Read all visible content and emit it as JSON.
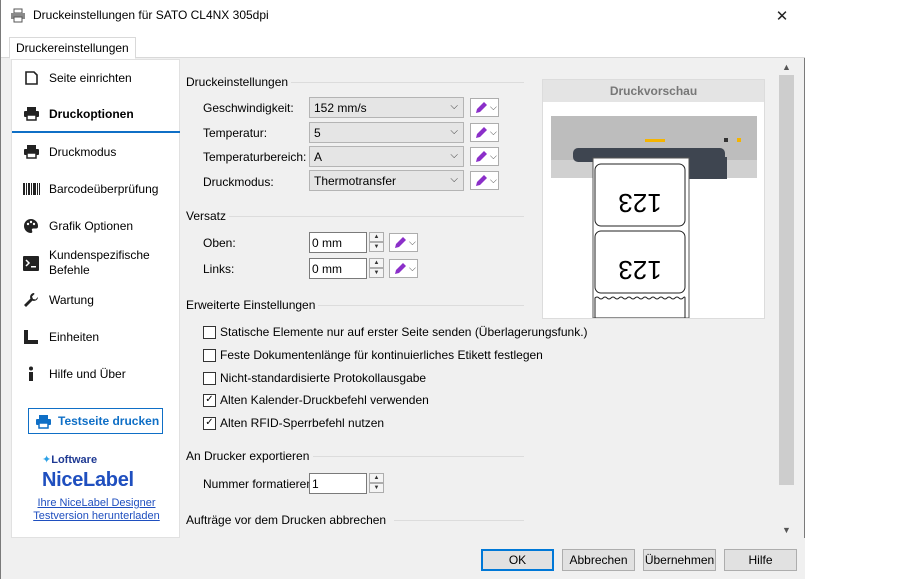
{
  "window": {
    "title": "Druckeinstellungen für SATO CL4NX 305dpi",
    "close": "✕"
  },
  "tabs": [
    {
      "label": "Druckereinstellungen"
    }
  ],
  "sidebar": {
    "items": [
      {
        "label": "Seite einrichten",
        "icon": "page-icon"
      },
      {
        "label": "Druckoptionen",
        "icon": "printer-icon"
      },
      {
        "label": "Druckmodus",
        "icon": "printer-mode-icon"
      },
      {
        "label": "Barcodeüberprüfung",
        "icon": "barcode-icon"
      },
      {
        "label": "Grafik Optionen",
        "icon": "palette-icon"
      },
      {
        "label": "Kundenspezifische Befehle",
        "icon": "terminal-icon"
      },
      {
        "label": "Wartung",
        "icon": "wrench-icon"
      },
      {
        "label": "Einheiten",
        "icon": "ruler-icon"
      },
      {
        "label": "Hilfe und Über",
        "icon": "info-icon"
      }
    ],
    "active_index": 1,
    "test_page_button": "Testseite drucken",
    "brand": {
      "vendor": "Loftware",
      "product": "NiceLabel",
      "link1": "Ihre NiceLabel Designer",
      "link2": "Testversion herunterladen"
    }
  },
  "print_settings": {
    "heading": "Druckeinstellungen",
    "fields": [
      {
        "label": "Geschwindigkeit:",
        "value": "152 mm/s"
      },
      {
        "label": "Temperatur:",
        "value": "5"
      },
      {
        "label": "Temperaturbereich:",
        "value": "A"
      },
      {
        "label": "Druckmodus:",
        "value": "Thermotransfer"
      }
    ]
  },
  "offset": {
    "heading": "Versatz",
    "fields": [
      {
        "label": "Oben:",
        "value": "0 mm"
      },
      {
        "label": "Links:",
        "value": "0 mm"
      }
    ]
  },
  "advanced": {
    "heading": "Erweiterte Einstellungen",
    "checkboxes": [
      {
        "label": "Statische Elemente nur auf erster Seite senden (Überlagerungsfunk.)",
        "checked": false
      },
      {
        "label": "Feste Dokumentenlänge für kontinuierliches Etikett festlegen",
        "checked": false
      },
      {
        "label": "Nicht-standardisierte Protokollausgabe",
        "checked": false
      },
      {
        "label": "Alten Kalender-Druckbefehl verwenden",
        "checked": true
      },
      {
        "label": "Alten RFID-Sperrbefehl nutzen",
        "checked": true
      }
    ]
  },
  "export": {
    "heading": "An Drucker exportieren",
    "field_label": "Nummer formatieren:",
    "field_value": "1"
  },
  "abort": {
    "heading": "Aufträge vor dem Drucken abbrechen"
  },
  "preview": {
    "heading": "Druckvorschau",
    "label_text": "123"
  },
  "footer": {
    "ok": "OK",
    "cancel": "Abbrechen",
    "apply": "Übernehmen",
    "help": "Hilfe"
  },
  "colors": {
    "accent": "#0f6fc6",
    "pen": "#8b2fc9",
    "led": "#f5b400"
  }
}
